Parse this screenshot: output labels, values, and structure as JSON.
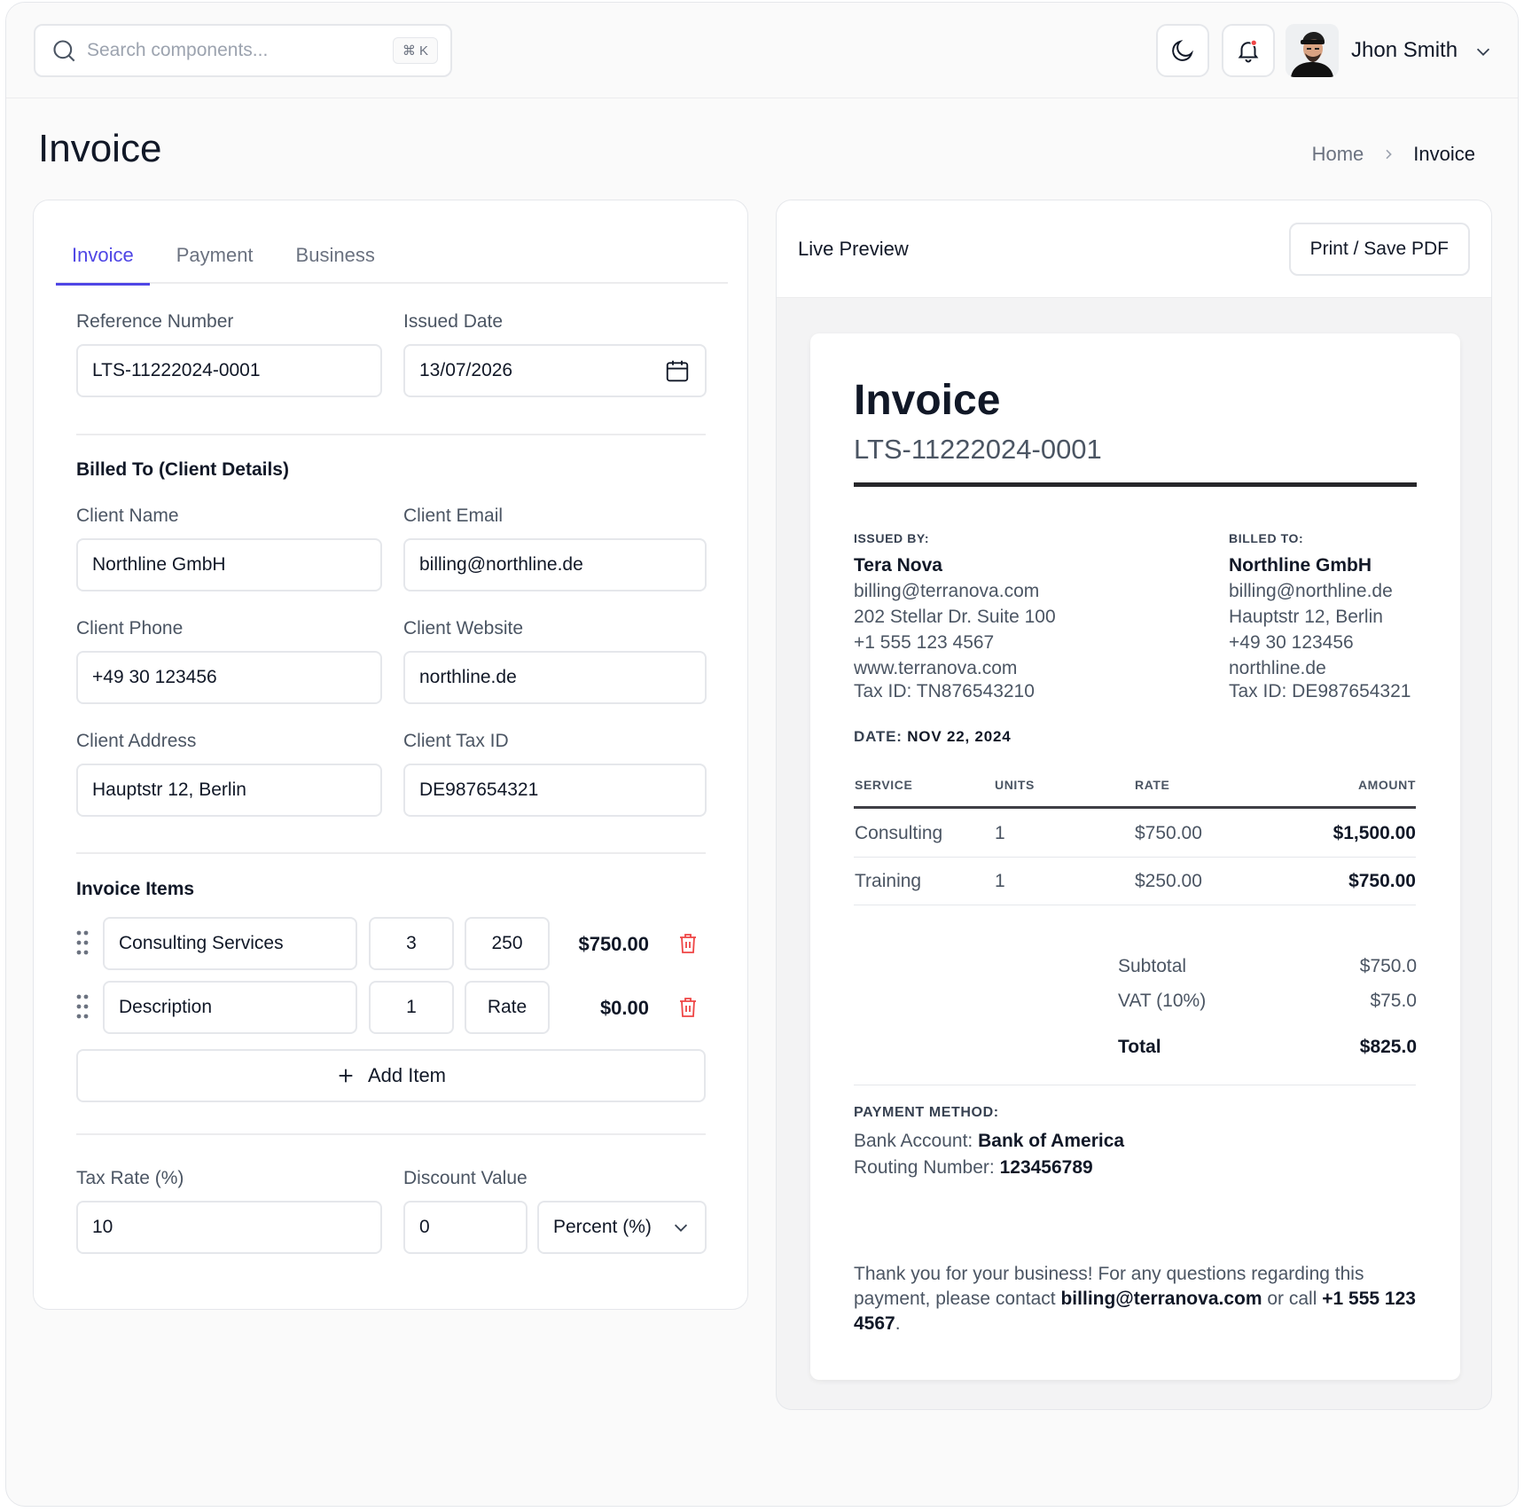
{
  "header": {
    "search_placeholder": "Search components...",
    "search_shortcut": "⌘ K",
    "user_name": "Jhon Smith",
    "notification_dot_color": "#ef4444"
  },
  "page": {
    "title": "Invoice",
    "breadcrumb": {
      "home": "Home",
      "current": "Invoice"
    }
  },
  "form": {
    "tabs": [
      "Invoice",
      "Payment",
      "Business"
    ],
    "active_tab": "Invoice",
    "reference_label": "Reference Number",
    "reference_value": "LTS-11222024-0001",
    "issued_label": "Issued Date",
    "issued_value": "13/07/2026",
    "billed_section": "Billed To (Client Details)",
    "client_name_label": "Client Name",
    "client_name": "Northline GmbH",
    "client_email_label": "Client Email",
    "client_email": "billing@northline.de",
    "client_phone_label": "Client Phone",
    "client_phone": "+49 30 123456",
    "client_website_label": "Client Website",
    "client_website": "northline.de",
    "client_address_label": "Client Address",
    "client_address": "Hauptstr 12, Berlin",
    "client_tax_label": "Client Tax ID",
    "client_tax": "DE987654321",
    "items_section": "Invoice Items",
    "items": [
      {
        "description": "Consulting Services",
        "qty": "3",
        "rate": "250",
        "amount": "$750.00"
      },
      {
        "description": "Description",
        "qty": "1",
        "rate": "Rate",
        "amount": "$0.00"
      }
    ],
    "add_item": "Add Item",
    "tax_rate_label": "Tax Rate (%)",
    "tax_rate": "10",
    "discount_label": "Discount Value",
    "discount_value": "0",
    "discount_type": "Percent (%)"
  },
  "preview": {
    "title": "Live Preview",
    "print_button": "Print / Save PDF",
    "doc_title": "Invoice",
    "doc_ref": "LTS-11222024-0001",
    "issued_by_caption": "ISSUED BY:",
    "issued_by": {
      "name": "Tera Nova",
      "email": "billing@terranova.com",
      "address": "202 Stellar Dr. Suite 100",
      "phone": "+1 555 123 4567",
      "website": "www.terranova.com",
      "tax": "Tax ID: TN876543210"
    },
    "billed_to_caption": "BILLED TO:",
    "billed_to": {
      "name": "Northline GmbH",
      "email": "billing@northline.de",
      "address": "Hauptstr 12, Berlin",
      "phone": "+49 30 123456",
      "website": "northline.de",
      "tax": "Tax ID: DE987654321"
    },
    "date_caption": "DATE:",
    "date_value": "NOV 22, 2024",
    "table_headers": [
      "SERVICE",
      "UNITS",
      "RATE",
      "AMOUNT"
    ],
    "rows": [
      {
        "service": "Consulting",
        "units": "1",
        "rate": "$750.00",
        "amount": "$1,500.00"
      },
      {
        "service": "Training",
        "units": "1",
        "rate": "$250.00",
        "amount": "$750.00"
      }
    ],
    "subtotal_label": "Subtotal",
    "subtotal": "$750.0",
    "vat_label": "VAT (10%)",
    "vat": "$75.0",
    "total_label": "Total",
    "total": "$825.0",
    "payment_caption": "PAYMENT METHOD:",
    "bank_label": "Bank Account:",
    "bank_value": "Bank of America",
    "routing_label": "Routing Number:",
    "routing_value": "123456789",
    "thanks_text_1": "Thank you for your business! For any questions regarding this payment, please contact",
    "thanks_email": "billing@terranova.com",
    "thanks_text_2": "or call",
    "thanks_phone": "+1 555 123 4567",
    "thanks_end": "."
  },
  "colors": {
    "accent": "#4f46e5",
    "danger": "#ef4444",
    "rule": "#27272a"
  }
}
